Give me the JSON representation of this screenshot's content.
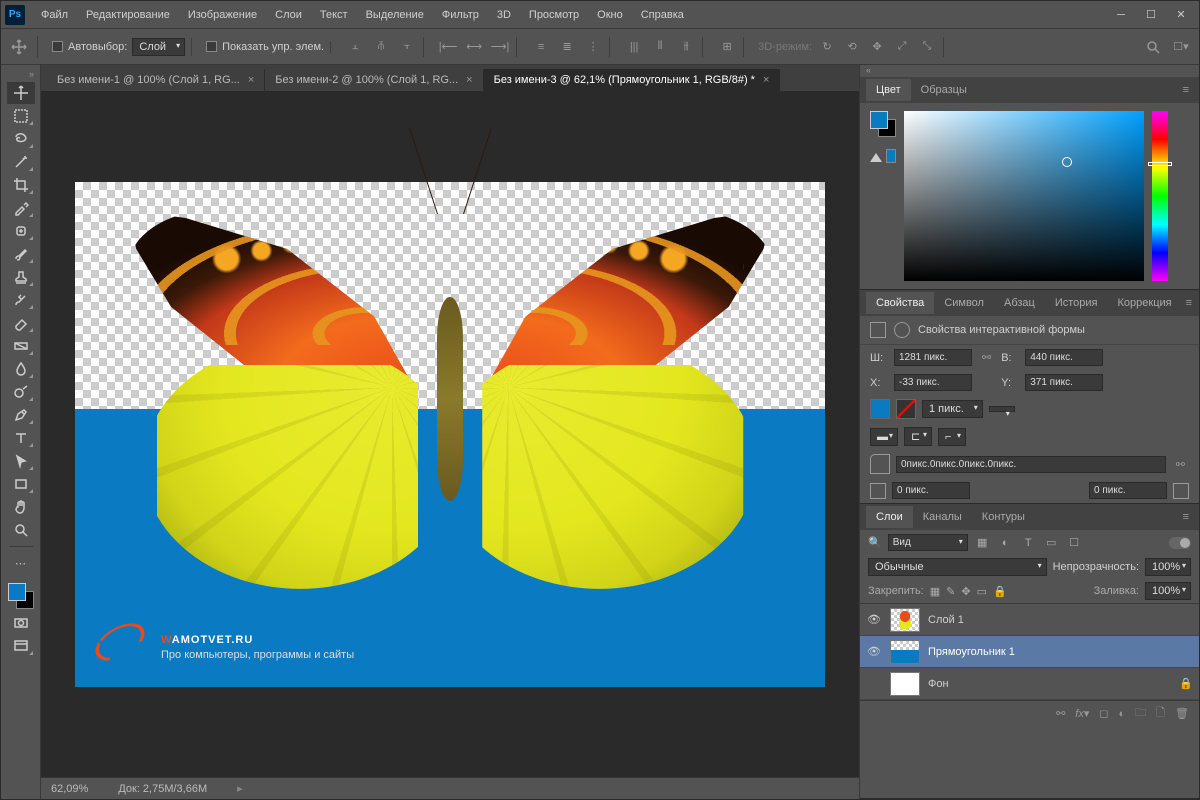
{
  "menu": [
    "Файл",
    "Редактирование",
    "Изображение",
    "Слои",
    "Текст",
    "Выделение",
    "Фильтр",
    "3D",
    "Просмотр",
    "Окно",
    "Справка"
  ],
  "options": {
    "autoSelect": "Автовыбор:",
    "layerDropdown": "Слой",
    "showTransform": "Показать упр. элем.",
    "mode3d": "3D-режим:"
  },
  "tabs": [
    {
      "label": "Без имени-1 @ 100% (Слой 1, RG...",
      "active": false
    },
    {
      "label": "Без имени-2 @ 100% (Слой 1, RG...",
      "active": false
    },
    {
      "label": "Без имени-3 @ 62,1% (Прямоугольник 1, RGB/8#) *",
      "active": true
    }
  ],
  "status": {
    "zoom": "62,09%",
    "doc": "Док: 2,75M/3,66M"
  },
  "watermark": {
    "brandOrange": "W",
    "brandWhite": "AMOTVET.RU",
    "sub": "Про компьютеры, программы и сайты"
  },
  "panels": {
    "color": {
      "tabs": [
        "Цвет",
        "Образцы"
      ]
    },
    "props": {
      "tabs": [
        "Свойства",
        "Символ",
        "Абзац",
        "История",
        "Коррекция"
      ],
      "title": "Свойства интерактивной формы",
      "W": "Ш:",
      "Wv": "1281 пикс.",
      "H": "В:",
      "Hv": "440 пикс.",
      "X": "X:",
      "Xv": "-33 пикс.",
      "Y": "Y:",
      "Yv": "371 пикс.",
      "stroke": "1 пикс.",
      "radius": "0пикс.0пикс.0пикс.0пикс.",
      "r1": "0 пикс.",
      "r2": "0 пикс."
    },
    "layers": {
      "tabs": [
        "Слои",
        "Каналы",
        "Контуры"
      ],
      "search": "Вид",
      "blend": "Обычные",
      "opacityLbl": "Непрозрачность:",
      "opacity": "100%",
      "lockLbl": "Закрепить:",
      "fillLbl": "Заливка:",
      "fill": "100%",
      "items": [
        {
          "name": "Слой 1",
          "vis": true,
          "sel": false,
          "type": "butterfly"
        },
        {
          "name": "Прямоугольник 1",
          "vis": true,
          "sel": true,
          "type": "blue"
        },
        {
          "name": "Фон",
          "vis": false,
          "sel": false,
          "type": "white"
        }
      ]
    }
  },
  "colors": {
    "fg": "#0a7ac2",
    "bg": "#000000"
  }
}
